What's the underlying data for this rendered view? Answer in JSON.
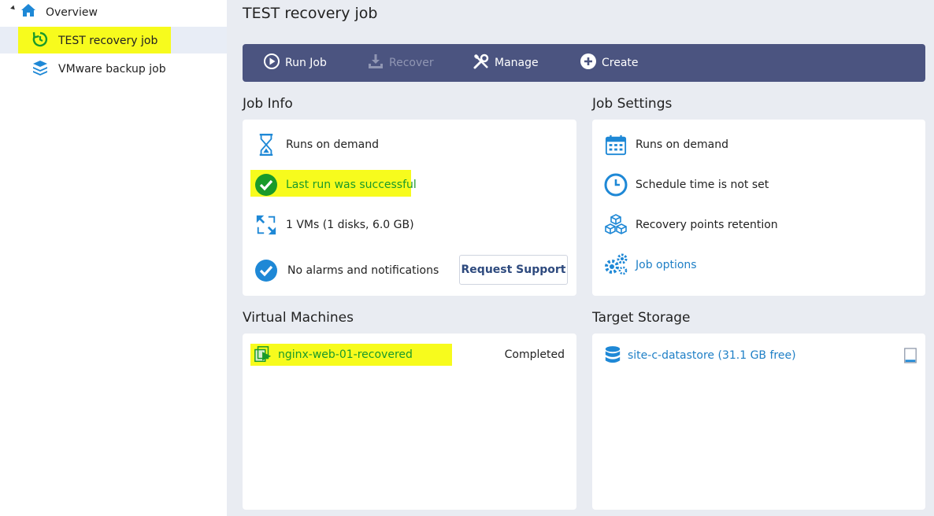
{
  "sidebar": {
    "root": "Overview",
    "items": [
      {
        "label": "TEST recovery job",
        "selected": true
      },
      {
        "label": "VMware backup job",
        "selected": false
      }
    ]
  },
  "main": {
    "title": "TEST recovery job",
    "toolbar": {
      "run_job": "Run Job",
      "recover": "Recover",
      "manage": "Manage",
      "create": "Create"
    },
    "job_info": {
      "title": "Job Info",
      "runs": "Runs on demand",
      "last_run": "Last run was successful",
      "vms": "1 VMs (1 disks, 6.0 GB)",
      "alarms": "No alarms and notifications",
      "request_support": "Request Support"
    },
    "job_settings": {
      "title": "Job Settings",
      "runs": "Runs on demand",
      "schedule": "Schedule time is not set",
      "retention": "Recovery points retention",
      "options": "Job options"
    },
    "virtual_machines": {
      "title": "Virtual Machines",
      "items": [
        {
          "name": "nginx-web-01-recovered",
          "status": "Completed"
        }
      ]
    },
    "target_storage": {
      "title": "Target Storage",
      "items": [
        {
          "name": "site-c-datastore (31.1 GB free)"
        }
      ]
    }
  },
  "colors": {
    "highlight": "#f7fb1d",
    "toolbar": "#4b5480",
    "accent": "#1e7fc6",
    "success": "#1a9a2a"
  }
}
